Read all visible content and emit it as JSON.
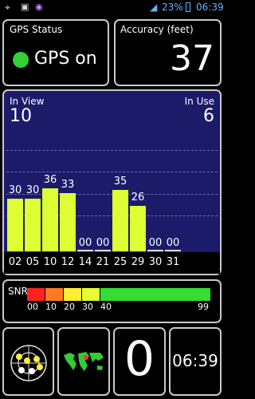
{
  "status_bar": {
    "battery_percent": "23%",
    "clock": "06:39"
  },
  "gps_status": {
    "title": "GPS Status",
    "state": "GPS on",
    "indicator_color": "#33d133"
  },
  "accuracy": {
    "title": "Accuracy (feet)",
    "value": "37"
  },
  "satellites": {
    "in_view_label": "In View",
    "in_view_value": "10",
    "in_use_label": "In Use",
    "in_use_value": "6",
    "prns": [
      "02",
      "05",
      "10",
      "12",
      "14",
      "21",
      "25",
      "29",
      "30",
      "31"
    ],
    "snr": [
      "30",
      "30",
      "36",
      "33",
      "00",
      "00",
      "35",
      "26",
      "00",
      "00"
    ],
    "in_use": [
      true,
      true,
      true,
      true,
      false,
      false,
      true,
      true,
      false,
      false
    ]
  },
  "chart_data": {
    "type": "bar",
    "categories": [
      "02",
      "05",
      "10",
      "12",
      "14",
      "21",
      "25",
      "29",
      "30",
      "31"
    ],
    "values": [
      30,
      30,
      36,
      33,
      0,
      0,
      35,
      26,
      0,
      0
    ],
    "title": "",
    "xlabel": "",
    "ylabel": "",
    "ylim": [
      0,
      99
    ]
  },
  "snr_legend": {
    "label": "SNR",
    "ticks": [
      "00",
      "10",
      "20",
      "30",
      "40",
      "99"
    ],
    "colors": [
      "#ff2222",
      "#ff7a22",
      "#ffee33",
      "#e6ff33",
      "#33dd33"
    ]
  },
  "bottom": {
    "sky_icon": "satellite-radar-icon",
    "map_icon": "world-map-icon",
    "count": "0",
    "time": "06:39"
  }
}
